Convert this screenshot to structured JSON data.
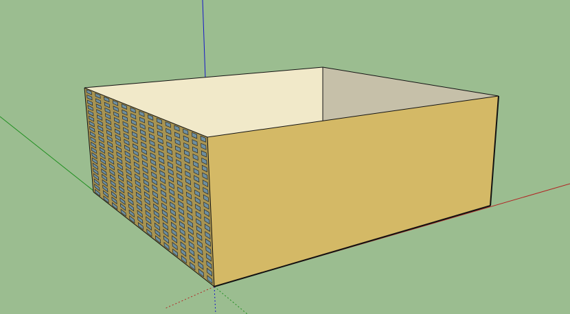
{
  "viewport": {
    "background_color": "#9bbd90"
  },
  "axes": {
    "red_axis_color": "#b22222",
    "green_axis_color": "#1e8f1e",
    "blue_axis_color": "#1515c8"
  },
  "box": {
    "top_face_color": "#f1e9c9",
    "inner_back_wall_color": "#c6c0a9",
    "front_face_color": "#d4b966",
    "left_face_color": "#a89452",
    "window_color": "#6e8fa0",
    "edge_color": "#111111",
    "window_grid": {
      "rows": 20,
      "columns": 14
    }
  }
}
